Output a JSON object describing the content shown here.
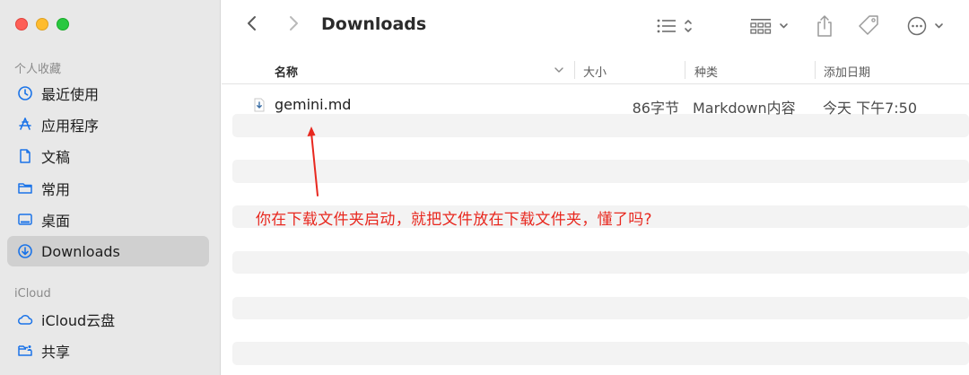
{
  "sidebar": {
    "favorites_label": "个人收藏",
    "favorites": [
      {
        "label": "最近使用",
        "icon": "clock-icon"
      },
      {
        "label": "应用程序",
        "icon": "applications-icon"
      },
      {
        "label": "文稿",
        "icon": "document-icon"
      },
      {
        "label": "常用",
        "icon": "folder-icon"
      },
      {
        "label": "桌面",
        "icon": "desktop-icon"
      },
      {
        "label": "Downloads",
        "icon": "downloads-icon",
        "selected": true
      }
    ],
    "icloud_label": "iCloud",
    "icloud": [
      {
        "label": "iCloud云盘",
        "icon": "cloud-icon"
      },
      {
        "label": "共享",
        "icon": "shared-folder-icon"
      }
    ]
  },
  "toolbar": {
    "title": "Downloads",
    "icons": [
      "back-icon",
      "forward-icon",
      "list-view-icon",
      "group-view-icon",
      "share-icon",
      "tag-icon",
      "more-icon"
    ]
  },
  "columns": {
    "name": "名称",
    "size": "大小",
    "kind": "种类",
    "date_added": "添加日期"
  },
  "files": [
    {
      "name": "gemini.md",
      "size": "86字节",
      "kind": "Markdown内容",
      "date_added": "今天 下午7:50"
    }
  ],
  "annotation": {
    "text": "你在下载文件夹启动，就把文件放在下载文件夹，懂了吗?",
    "color": "#e8281f"
  },
  "colors": {
    "sidebar_bg": "#e8e8e8",
    "selected_bg": "#d0d0d0",
    "accent": "#1a73e8"
  }
}
